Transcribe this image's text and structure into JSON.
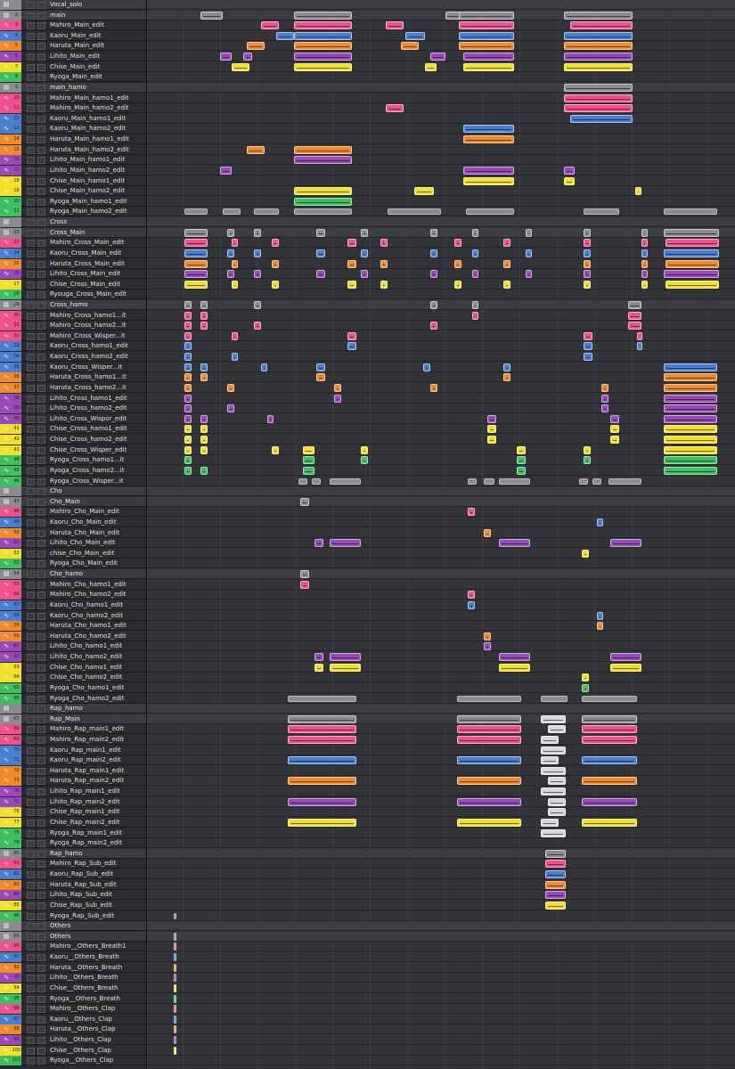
{
  "colors": {
    "pink": "#f0508c",
    "blue": "#4a7fd0",
    "orange": "#f08a2a",
    "purple": "#9a4ab8",
    "yellow": "#f0e02a",
    "green": "#3cc060",
    "gray": "#8a8c90",
    "white": "#d8d8dc"
  },
  "tracks": [
    {
      "name": "Vocal_solo",
      "kind": "folder",
      "num": "",
      "color": "gray"
    },
    {
      "name": "main",
      "kind": "folder",
      "num": "2",
      "color": "gray"
    },
    {
      "name": "Mahiro_Main_edit",
      "kind": "audio",
      "num": "3",
      "color": "pink"
    },
    {
      "name": "Kaoru_Main_edit",
      "kind": "audio",
      "num": "4",
      "color": "blue"
    },
    {
      "name": "Haruta_Main_edit",
      "kind": "audio",
      "num": "5",
      "color": "orange"
    },
    {
      "name": "Lihito_Main_edit",
      "kind": "audio",
      "num": "6",
      "color": "purple"
    },
    {
      "name": "Chise_Main_edit",
      "kind": "audio",
      "num": "7",
      "color": "yellow"
    },
    {
      "name": "Ryoga_Main_edit",
      "kind": "audio",
      "num": "8",
      "color": "green"
    },
    {
      "name": "main_hamo",
      "kind": "folder",
      "num": "9",
      "color": "gray"
    },
    {
      "name": "Mahiro_Main_hamo1_edit",
      "kind": "audio",
      "num": "10",
      "color": "pink"
    },
    {
      "name": "Mahiro_Main_hamo2_edit",
      "kind": "audio",
      "num": "11",
      "color": "pink"
    },
    {
      "name": "Kaoru_Main_hamo1_edit",
      "kind": "audio",
      "num": "12",
      "color": "blue"
    },
    {
      "name": "Kaoru_Main_hamo2_edit",
      "kind": "audio",
      "num": "13",
      "color": "blue"
    },
    {
      "name": "Haruta_Main_hamo1_edit",
      "kind": "audio",
      "num": "14",
      "color": "orange"
    },
    {
      "name": "Haruta_Main_hamo2_edit",
      "kind": "audio",
      "num": "15",
      "color": "orange"
    },
    {
      "name": "Lihito_Main_hamo1_edit",
      "kind": "audio",
      "num": "16",
      "color": "purple"
    },
    {
      "name": "Lihito_Main_hamo2_edit",
      "kind": "audio",
      "num": "17",
      "color": "purple"
    },
    {
      "name": "Chise_Main_hamo1_edit",
      "kind": "audio",
      "num": "18",
      "color": "yellow"
    },
    {
      "name": "Chise_Main_hamo2_edit",
      "kind": "audio",
      "num": "19",
      "color": "yellow"
    },
    {
      "name": "Ryoga_Main_hamo1_edit",
      "kind": "audio",
      "num": "20",
      "color": "green"
    },
    {
      "name": "Ryoga_Main_hamo2_edit",
      "kind": "audio",
      "num": "21",
      "color": "green"
    },
    {
      "name": "Cross",
      "kind": "folder",
      "num": "",
      "color": "gray"
    },
    {
      "name": "Cross_Main",
      "kind": "folder",
      "num": "22",
      "color": "gray"
    },
    {
      "name": "Mahiro_Cross_Main_edit",
      "kind": "audio",
      "num": "23",
      "color": "pink"
    },
    {
      "name": "Kaoru_Cross_Main_edit",
      "kind": "audio",
      "num": "24",
      "color": "blue"
    },
    {
      "name": "Haruta_Cross_Main_edit",
      "kind": "audio",
      "num": "25",
      "color": "orange"
    },
    {
      "name": "Lihito_Cross_Main_edit",
      "kind": "audio",
      "num": "26",
      "color": "purple"
    },
    {
      "name": "Chise_Cross_Main_edit",
      "kind": "audio",
      "num": "27",
      "color": "yellow"
    },
    {
      "name": "Ryouga_Cross_Main_edit",
      "kind": "audio",
      "num": "28",
      "color": "green"
    },
    {
      "name": "Cross_hamo",
      "kind": "folder",
      "num": "29",
      "color": "gray"
    },
    {
      "name": "Mahiro_Cross_hamo1...it",
      "kind": "audio",
      "num": "30",
      "color": "pink"
    },
    {
      "name": "Mahiro_Cross_hamo2...it",
      "kind": "audio",
      "num": "31",
      "color": "pink"
    },
    {
      "name": "Mahiro_Cross_Wisper...it",
      "kind": "audio",
      "num": "32",
      "color": "pink"
    },
    {
      "name": "Kaoru_Cross_hamo1_edit",
      "kind": "audio",
      "num": "33",
      "color": "blue"
    },
    {
      "name": "Kaoru_Cross_hamo2_edit",
      "kind": "audio",
      "num": "34",
      "color": "blue"
    },
    {
      "name": "Kaoru_Cross_Wisper...it",
      "kind": "audio",
      "num": "35",
      "color": "blue"
    },
    {
      "name": "Haruta_Cross_hamo1...it",
      "kind": "audio",
      "num": "36",
      "color": "orange"
    },
    {
      "name": "Haruta_Cross_hamo2...it",
      "kind": "audio",
      "num": "37",
      "color": "orange"
    },
    {
      "name": "Lihito_Cross_hamo1_edit",
      "kind": "audio",
      "num": "38",
      "color": "purple"
    },
    {
      "name": "Lihito_Cross_hamo2_edit",
      "kind": "audio",
      "num": "39",
      "color": "purple"
    },
    {
      "name": "Lihito_Cross_Wispor_edit",
      "kind": "audio",
      "num": "40",
      "color": "purple"
    },
    {
      "name": "Chise_Cross_hamo1_edit",
      "kind": "audio",
      "num": "41",
      "color": "yellow"
    },
    {
      "name": "Chise_Cross_hamo2_edit",
      "kind": "audio",
      "num": "42",
      "color": "yellow"
    },
    {
      "name": "Chise_Cross_Wisper_edit",
      "kind": "audio",
      "num": "43",
      "color": "yellow"
    },
    {
      "name": "Ryoga_Cross_hamo1...it",
      "kind": "audio",
      "num": "44",
      "color": "green"
    },
    {
      "name": "Ryoga_Cross_hamo2...it",
      "kind": "audio",
      "num": "45",
      "color": "green"
    },
    {
      "name": "Ryoga_Cross_Wisper...it",
      "kind": "audio",
      "num": "46",
      "color": "green"
    },
    {
      "name": "Cho",
      "kind": "folder",
      "num": "",
      "color": "gray"
    },
    {
      "name": "Cho_Main",
      "kind": "folder",
      "num": "47",
      "color": "gray"
    },
    {
      "name": "Mahiro_Cho_Main_edit",
      "kind": "audio",
      "num": "48",
      "color": "pink"
    },
    {
      "name": "Kaoru_Cho_Main_edit",
      "kind": "audio",
      "num": "49",
      "color": "blue"
    },
    {
      "name": "Haruta_Cho_Main_edit",
      "kind": "audio",
      "num": "50",
      "color": "orange"
    },
    {
      "name": "Lihito_Cho_Main_edit",
      "kind": "audio",
      "num": "51",
      "color": "purple"
    },
    {
      "name": "chise_Cho_Main_edit",
      "kind": "audio",
      "num": "52",
      "color": "yellow"
    },
    {
      "name": "Ryoga_Cho_Main_edit",
      "kind": "audio",
      "num": "53",
      "color": "green"
    },
    {
      "name": "Cho_hamo",
      "kind": "folder",
      "num": "54",
      "color": "gray"
    },
    {
      "name": "Mahiro_Cho_hamo1_edit",
      "kind": "audio",
      "num": "55",
      "color": "pink"
    },
    {
      "name": "Mahiro_Cho_hamo2_edit",
      "kind": "audio",
      "num": "56",
      "color": "pink"
    },
    {
      "name": "Kaoru_Cho_hamo1_edit",
      "kind": "audio",
      "num": "57",
      "color": "blue"
    },
    {
      "name": "Kaoru_Cho_hamo2_edit",
      "kind": "audio",
      "num": "58",
      "color": "blue"
    },
    {
      "name": "Haruta_Cho_hamo1_edit",
      "kind": "audio",
      "num": "59",
      "color": "orange"
    },
    {
      "name": "Haruta_Cho_hamo2_edit",
      "kind": "audio",
      "num": "60",
      "color": "orange"
    },
    {
      "name": "Lihito_Cho_hamo1_edit",
      "kind": "audio",
      "num": "61",
      "color": "purple"
    },
    {
      "name": "Lihito_Cho_hamo2_edit",
      "kind": "audio",
      "num": "62",
      "color": "purple"
    },
    {
      "name": "Chise_Cho_hamo1_edit",
      "kind": "audio",
      "num": "63",
      "color": "yellow"
    },
    {
      "name": "Chise_Cho_hamo2_edit",
      "kind": "audio",
      "num": "64",
      "color": "yellow"
    },
    {
      "name": "Ryoga_Cho_hamo1_edit",
      "kind": "audio",
      "num": "65",
      "color": "green"
    },
    {
      "name": "Ryoga_Cho_hamo2_edit",
      "kind": "audio",
      "num": "66",
      "color": "green"
    },
    {
      "name": "Rap_hamo",
      "kind": "folder",
      "num": "",
      "color": "gray"
    },
    {
      "name": "Rap_Main",
      "kind": "folder",
      "num": "67",
      "color": "gray"
    },
    {
      "name": "Mahiro_Rap_main1_edit",
      "kind": "audio",
      "num": "68",
      "color": "pink"
    },
    {
      "name": "Mahiro_Rap_main2_edit",
      "kind": "audio",
      "num": "69",
      "color": "pink"
    },
    {
      "name": "Kaoru_Rap_main1_edit",
      "kind": "audio",
      "num": "70",
      "color": "blue"
    },
    {
      "name": "Kaoru_Rap_main2_edit",
      "kind": "audio",
      "num": "71",
      "color": "blue"
    },
    {
      "name": "Haruta_Rap_main1_edit",
      "kind": "audio",
      "num": "72",
      "color": "orange"
    },
    {
      "name": "Haruta_Rap_main2_edit",
      "kind": "audio",
      "num": "73",
      "color": "orange"
    },
    {
      "name": "Lihito_Rap_main1_edit",
      "kind": "audio",
      "num": "74",
      "color": "purple"
    },
    {
      "name": "Lihito_Rap_main2_edit",
      "kind": "audio",
      "num": "75",
      "color": "purple"
    },
    {
      "name": "Chise_Rap_main1_edit",
      "kind": "audio",
      "num": "76",
      "color": "yellow"
    },
    {
      "name": "Chise_Rap_main2_edit",
      "kind": "audio",
      "num": "77",
      "color": "yellow"
    },
    {
      "name": "Ryoga_Rap_main1_edit",
      "kind": "audio",
      "num": "78",
      "color": "green"
    },
    {
      "name": "Ryoga_Rap_main2_edit",
      "kind": "audio",
      "num": "79",
      "color": "green"
    },
    {
      "name": "Rap_hamo",
      "kind": "folder",
      "num": "80",
      "color": "gray"
    },
    {
      "name": "Mahiro_Rap_Sub_edit",
      "kind": "audio",
      "num": "81",
      "color": "pink"
    },
    {
      "name": "Kaoru_Rap_Sub_edit",
      "kind": "audio",
      "num": "82",
      "color": "blue"
    },
    {
      "name": "Haruta_Rap_Sub_edit",
      "kind": "audio",
      "num": "83",
      "color": "orange"
    },
    {
      "name": "Lihito_Rap_Sub_edit",
      "kind": "audio",
      "num": "84",
      "color": "purple"
    },
    {
      "name": "Chise_Rap_Sub_edit",
      "kind": "audio",
      "num": "85",
      "color": "yellow"
    },
    {
      "name": "Ryoga_Rap_Sub_edit",
      "kind": "audio",
      "num": "86",
      "color": "green"
    },
    {
      "name": "Others",
      "kind": "folder",
      "num": "",
      "color": "gray"
    },
    {
      "name": "Others",
      "kind": "folder",
      "num": "89",
      "color": "gray"
    },
    {
      "name": "Mahiro__Others_Breath1",
      "kind": "audio",
      "num": "90",
      "color": "pink"
    },
    {
      "name": "Kaoru__Others_Breath",
      "kind": "audio",
      "num": "91",
      "color": "blue"
    },
    {
      "name": "Haruta__Others_Breath",
      "kind": "audio",
      "num": "92",
      "color": "orange"
    },
    {
      "name": "Lihito__Others_Breath",
      "kind": "audio",
      "num": "93",
      "color": "purple"
    },
    {
      "name": "Chise__Others_Breath",
      "kind": "audio",
      "num": "94",
      "color": "yellow"
    },
    {
      "name": "Ryoga__Others_Breath",
      "kind": "audio",
      "num": "95",
      "color": "green"
    },
    {
      "name": "Mahiro__Others_Clap",
      "kind": "audio",
      "num": "96",
      "color": "pink"
    },
    {
      "name": "Kaoru__Others_Clap",
      "kind": "audio",
      "num": "97",
      "color": "blue"
    },
    {
      "name": "Haruta__Others_Clap",
      "kind": "audio",
      "num": "98",
      "color": "orange"
    },
    {
      "name": "Lihito__Others_Clap",
      "kind": "audio",
      "num": "99",
      "color": "purple"
    },
    {
      "name": "Chise__Others_Clap",
      "kind": "audio",
      "num": "100",
      "color": "yellow"
    },
    {
      "name": "Ryoga__Others_Clap",
      "kind": "audio",
      "num": "101",
      "color": "green"
    }
  ],
  "icons": {
    "folder": "folder-icon",
    "audio": "waveform-icon"
  }
}
